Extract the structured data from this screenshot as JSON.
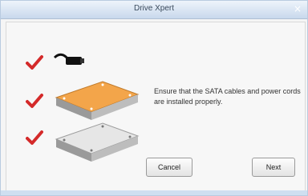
{
  "window": {
    "title": "Drive Xpert",
    "close_label": "×"
  },
  "message": "Ensure that the SATA cables and power cords are installed properly.",
  "buttons": {
    "cancel": "Cancel",
    "next": "Next"
  },
  "icons": {
    "check": "checkmark-icon",
    "cable": "sata-cable-icon",
    "drive_source": "hard-drive-orange-icon",
    "drive_target": "hard-drive-silver-icon"
  },
  "colors": {
    "check": "#d42a2a",
    "accent_drive": "#f0a040",
    "titlebar": "#c8d8ec"
  }
}
